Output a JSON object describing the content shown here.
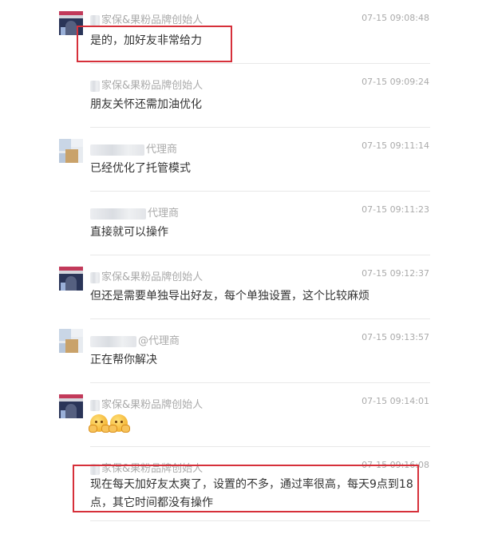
{
  "messages": [
    {
      "sender_visible": "家保&果粉品牌创始人",
      "time": "07-15 09:08:48",
      "text": "是的，加好友非常给力",
      "avatar": "poster-avatar"
    },
    {
      "sender_visible": "家保&果粉品牌创始人",
      "time": "07-15 09:09:24",
      "text": "朋友关怀还需加油优化",
      "avatar": "none"
    },
    {
      "sender_visible": "代理商",
      "time": "07-15 09:11:14",
      "text": "已经优化了托管模式",
      "avatar": "blurred-avatar"
    },
    {
      "sender_visible": "代理商",
      "time": "07-15 09:11:23",
      "text": "直接就可以操作",
      "avatar": "none"
    },
    {
      "sender_visible": "家保&果粉品牌创始人",
      "time": "07-15 09:12:37",
      "text": "但还是需要单独导出好友，每个单独设置，这个比较麻烦",
      "avatar": "poster-avatar"
    },
    {
      "sender_visible": "@代理商",
      "time": "07-15 09:13:57",
      "text": "正在帮你解决",
      "avatar": "blurred-avatar"
    },
    {
      "sender_visible": "家保&果粉品牌创始人",
      "time": "07-15 09:14:01",
      "text": "",
      "emojis": [
        "sweat-smile-emoji",
        "sweat-smile-emoji"
      ],
      "avatar": "poster-avatar"
    },
    {
      "sender_visible": "家保&果粉品牌创始人",
      "time": "07-15 09:16:08",
      "text": "现在每天加好友太爽了，设置的不多，通过率很高，每天9点到18点，其它时间都没有操作",
      "avatar": "none"
    }
  ],
  "colors": {
    "highlight": "#d6303a",
    "sender_text": "#aaaaaa",
    "message_text": "#333333"
  }
}
